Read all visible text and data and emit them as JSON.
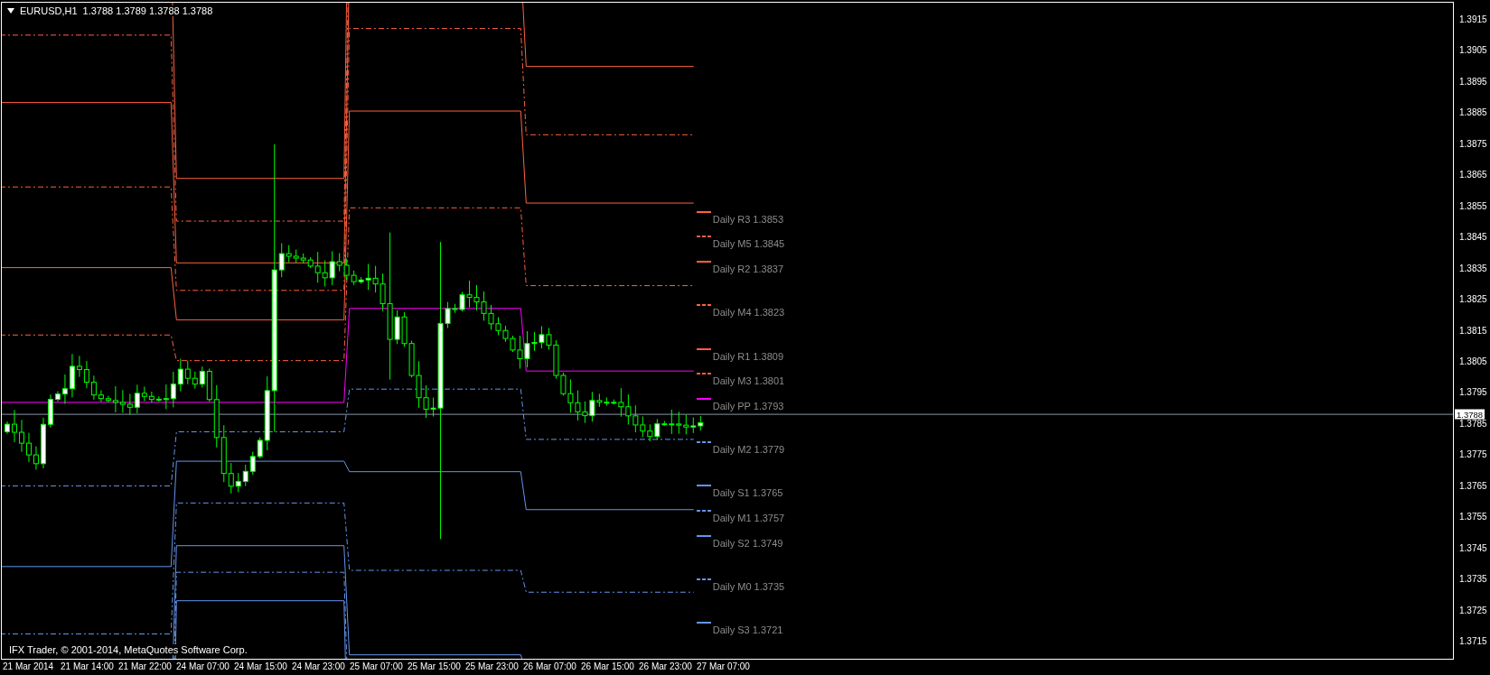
{
  "chart": {
    "symbol": "EURUSD,H1",
    "quote": "1.3788 1.3789 1.3788 1.3788",
    "copyright": "IFX Trader, © 2001-2014, MetaQuotes Software Corp.",
    "current_price": "1.3788",
    "pivot_labels": [
      {
        "label": "Daily R3 1.3853",
        "kind": "solid",
        "color": "#ff6040"
      },
      {
        "label": "Daily M5 1.3845",
        "kind": "dashed",
        "color": "#ff6040"
      },
      {
        "label": "Daily R2 1.3837",
        "kind": "solid",
        "color": "#ff6040"
      },
      {
        "label": "Daily M4 1.3823",
        "kind": "dashed",
        "color": "#ff6040"
      },
      {
        "label": "Daily R1 1.3809",
        "kind": "solid",
        "color": "#ff6040"
      },
      {
        "label": "Daily M3 1.3801",
        "kind": "dashed",
        "color": "#ff6040"
      },
      {
        "label": "Daily PP 1.3793",
        "kind": "solid",
        "color": "#ff00ff"
      },
      {
        "label": "Daily M2 1.3779",
        "kind": "dashed",
        "color": "#6495ed"
      },
      {
        "label": "Daily S1 1.3765",
        "kind": "solid",
        "color": "#6495ed"
      },
      {
        "label": "Daily M1 1.3757",
        "kind": "dashed",
        "color": "#6495ed"
      },
      {
        "label": "Daily S2 1.3749",
        "kind": "solid",
        "color": "#6495ed"
      },
      {
        "label": "Daily M0 1.3735",
        "kind": "dashed",
        "color": "#6495ed"
      },
      {
        "label": "Daily S3 1.3721",
        "kind": "solid",
        "color": "#6495ed"
      }
    ],
    "price_axis": [
      "1.3915",
      "1.3905",
      "1.3895",
      "1.3885",
      "1.3875",
      "1.3865",
      "1.3855",
      "1.3845",
      "1.3835",
      "1.3825",
      "1.3815",
      "1.3805",
      "1.3795",
      "1.3785",
      "1.3775",
      "1.3765",
      "1.3755",
      "1.3745",
      "1.3735",
      "1.3725",
      "1.3715"
    ],
    "time_axis": [
      "21 Mar 2014",
      "21 Mar 14:00",
      "21 Mar 22:00",
      "24 Mar 07:00",
      "24 Mar 15:00",
      "24 Mar 23:00",
      "25 Mar 07:00",
      "25 Mar 15:00",
      "25 Mar 23:00",
      "26 Mar 07:00",
      "26 Mar 15:00",
      "26 Mar 23:00",
      "27 Mar 07:00"
    ]
  }
}
